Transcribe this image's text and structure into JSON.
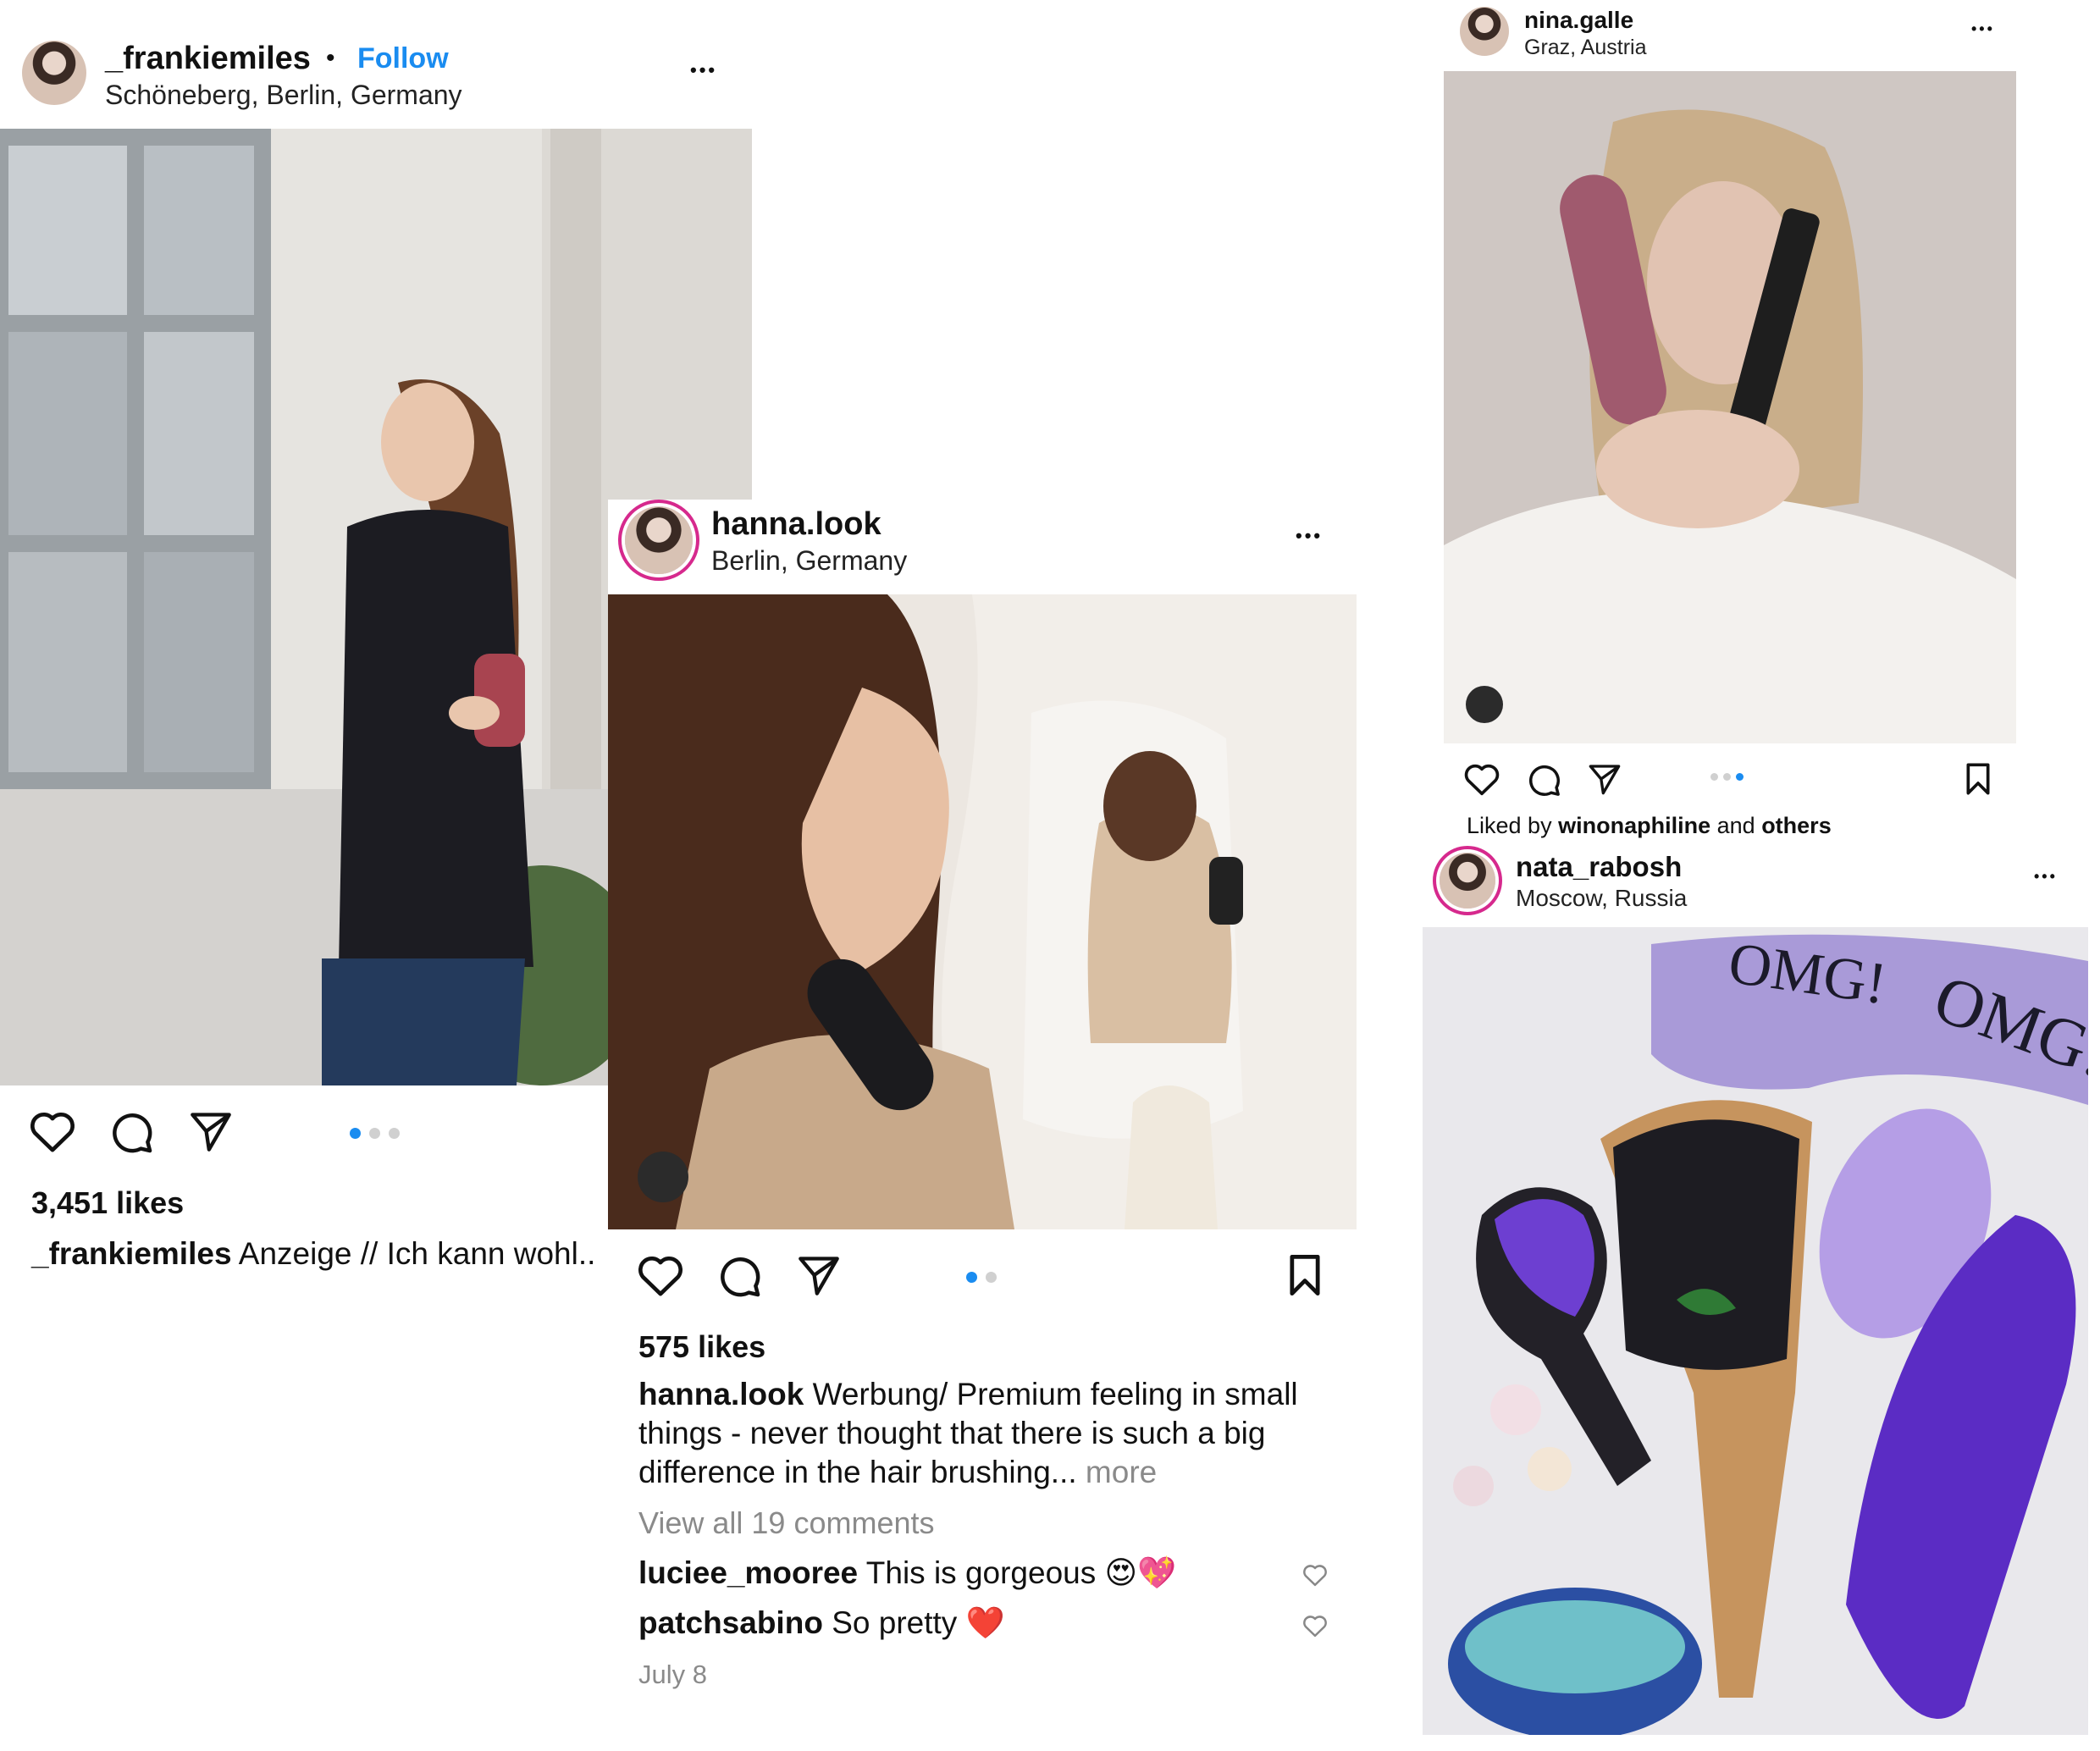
{
  "posts": [
    {
      "username": "_frankiemiles",
      "separator": "•",
      "follow_label": "Follow",
      "location": "Schöneberg, Berlin, Germany",
      "more": "•••",
      "likes": "3,451 likes",
      "caption_user": "_frankiemiles",
      "caption_text": "Anzeige // Ich kann wohl..",
      "carousel": {
        "count": 3,
        "active": 1
      }
    },
    {
      "username": "hanna.look",
      "location": "Berlin, Germany",
      "more": "•••",
      "likes": "575 likes",
      "caption_user": "hanna.look",
      "caption_line1": "Werbung/ Premium feeling in small",
      "caption_line2": "things - never thought that there is such a big",
      "caption_line3": "difference in the hair brushing...",
      "more_label": "more",
      "view_comments": "View all 19 comments",
      "comments": [
        {
          "user": "luciee_mooree",
          "text": "This is gorgeous 😍💖"
        },
        {
          "user": "patchsabino",
          "text": "So pretty ❤️"
        }
      ],
      "date": "July 8",
      "carousel": {
        "count": 2,
        "active": 1
      }
    },
    {
      "username": "nina.galle",
      "location": "Graz, Austria",
      "more": "•••",
      "liked_by_prefix": "Liked by",
      "liked_by_user": "winonaphiline",
      "liked_by_and": "and",
      "liked_by_others": "others",
      "carousel": {
        "count": 3,
        "active": 3
      }
    },
    {
      "username": "nata_rabosh",
      "location": "Moscow, Russia",
      "more": "•••",
      "photo_text_1": "OMG!",
      "photo_text_2": "OMG!"
    }
  ],
  "colors": {
    "follow_blue": "#1a8cf0",
    "active_dot": "#1a8cf0",
    "muted_text": "#8a8a8a",
    "heart_red": "#e0245e"
  }
}
